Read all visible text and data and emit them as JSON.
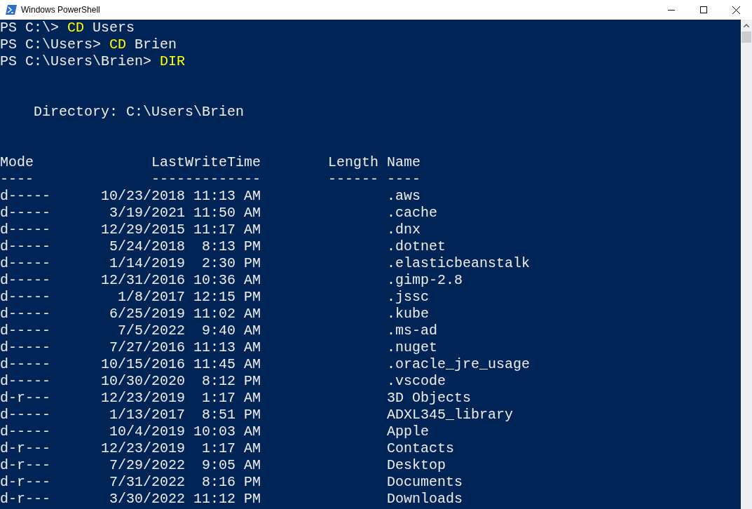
{
  "window": {
    "title": "Windows PowerShell"
  },
  "prompt_lines": [
    {
      "prompt": "PS C:\\>",
      "command": "CD",
      "argument": "Users"
    },
    {
      "prompt": "PS C:\\Users>",
      "command": "CD",
      "argument": "Brien"
    },
    {
      "prompt": "PS C:\\Users\\Brien>",
      "command": "DIR"
    }
  ],
  "directory": "    Directory: C:\\Users\\Brien",
  "table": {
    "columns": [
      "Mode",
      "LastWriteTime",
      "Length",
      "Name"
    ],
    "separators": [
      "----",
      "-------------",
      "------",
      "----"
    ],
    "rows": [
      {
        "mode": "d-----",
        "date": "10/23/2018",
        "time": "11:13 AM",
        "name": ".aws"
      },
      {
        "mode": "d-----",
        "date": "3/19/2021",
        "time": "11:50 AM",
        "name": ".cache"
      },
      {
        "mode": "d-----",
        "date": "12/29/2015",
        "time": "11:17 AM",
        "name": ".dnx"
      },
      {
        "mode": "d-----",
        "date": "5/24/2018",
        "time": "8:13 PM",
        "name": ".dotnet"
      },
      {
        "mode": "d-----",
        "date": "1/14/2019",
        "time": "2:30 PM",
        "name": ".elasticbeanstalk"
      },
      {
        "mode": "d-----",
        "date": "12/31/2016",
        "time": "10:36 AM",
        "name": ".gimp-2.8"
      },
      {
        "mode": "d-----",
        "date": "1/8/2017",
        "time": "12:15 PM",
        "name": ".jssc"
      },
      {
        "mode": "d-----",
        "date": "6/25/2019",
        "time": "11:02 AM",
        "name": ".kube"
      },
      {
        "mode": "d-----",
        "date": "7/5/2022",
        "time": "9:40 AM",
        "name": ".ms-ad"
      },
      {
        "mode": "d-----",
        "date": "7/27/2016",
        "time": "11:13 AM",
        "name": ".nuget"
      },
      {
        "mode": "d-----",
        "date": "10/15/2016",
        "time": "11:45 AM",
        "name": ".oracle_jre_usage"
      },
      {
        "mode": "d-----",
        "date": "10/30/2020",
        "time": "8:12 PM",
        "name": ".vscode"
      },
      {
        "mode": "d-r---",
        "date": "12/23/2019",
        "time": "1:17 AM",
        "name": "3D Objects"
      },
      {
        "mode": "d-----",
        "date": "1/13/2017",
        "time": "8:51 PM",
        "name": "ADXL345_library"
      },
      {
        "mode": "d-----",
        "date": "10/4/2019",
        "time": "10:03 AM",
        "name": "Apple"
      },
      {
        "mode": "d-r---",
        "date": "12/23/2019",
        "time": "1:17 AM",
        "name": "Contacts"
      },
      {
        "mode": "d-r---",
        "date": "7/29/2022",
        "time": "9:05 AM",
        "name": "Desktop"
      },
      {
        "mode": "d-r---",
        "date": "7/31/2022",
        "time": "8:16 PM",
        "name": "Documents"
      },
      {
        "mode": "d-r---",
        "date": "3/30/2022",
        "time": "11:12 PM",
        "name": "Downloads"
      }
    ]
  }
}
